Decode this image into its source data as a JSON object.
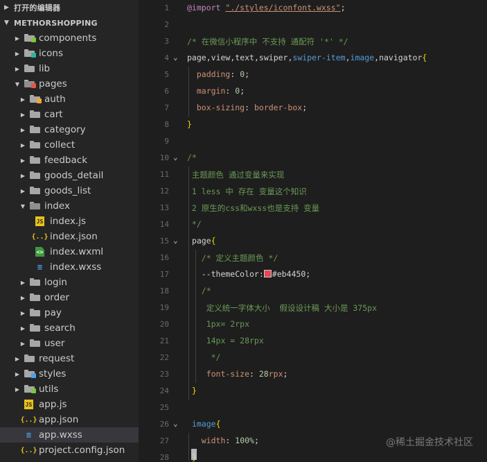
{
  "sidebar": {
    "open_editors": "打开的编辑器",
    "project": "METHORSHOPPING",
    "items": [
      {
        "label": "components",
        "type": "folder",
        "depth": 1,
        "expanded": false,
        "badge": "#7ec542"
      },
      {
        "label": "icons",
        "type": "folder",
        "depth": 1,
        "expanded": false,
        "badge": "#2fb39f"
      },
      {
        "label": "lib",
        "type": "folder",
        "depth": 1,
        "expanded": false,
        "badge": ""
      },
      {
        "label": "pages",
        "type": "folder",
        "depth": 1,
        "expanded": true,
        "badge": "#e2564a"
      },
      {
        "label": "auth",
        "type": "folder",
        "depth": 2,
        "expanded": false,
        "badge": "#f0a830"
      },
      {
        "label": "cart",
        "type": "folder",
        "depth": 2,
        "expanded": false,
        "badge": ""
      },
      {
        "label": "category",
        "type": "folder",
        "depth": 2,
        "expanded": false,
        "badge": ""
      },
      {
        "label": "collect",
        "type": "folder",
        "depth": 2,
        "expanded": false,
        "badge": ""
      },
      {
        "label": "feedback",
        "type": "folder",
        "depth": 2,
        "expanded": false,
        "badge": ""
      },
      {
        "label": "goods_detail",
        "type": "folder",
        "depth": 2,
        "expanded": false,
        "badge": ""
      },
      {
        "label": "goods_list",
        "type": "folder",
        "depth": 2,
        "expanded": false,
        "badge": ""
      },
      {
        "label": "index",
        "type": "folder",
        "depth": 2,
        "expanded": true,
        "badge": ""
      },
      {
        "label": "index.js",
        "type": "js",
        "depth": 3
      },
      {
        "label": "index.json",
        "type": "json",
        "depth": 3
      },
      {
        "label": "index.wxml",
        "type": "wxml",
        "depth": 3
      },
      {
        "label": "index.wxss",
        "type": "wxss",
        "depth": 3
      },
      {
        "label": "login",
        "type": "folder",
        "depth": 2,
        "expanded": false,
        "badge": ""
      },
      {
        "label": "order",
        "type": "folder",
        "depth": 2,
        "expanded": false,
        "badge": ""
      },
      {
        "label": "pay",
        "type": "folder",
        "depth": 2,
        "expanded": false,
        "badge": ""
      },
      {
        "label": "search",
        "type": "folder",
        "depth": 2,
        "expanded": false,
        "badge": ""
      },
      {
        "label": "user",
        "type": "folder",
        "depth": 2,
        "expanded": false,
        "badge": ""
      },
      {
        "label": "request",
        "type": "folder",
        "depth": 1,
        "expanded": false,
        "badge": ""
      },
      {
        "label": "styles",
        "type": "folder",
        "depth": 1,
        "expanded": false,
        "badge": "#4f9fe8"
      },
      {
        "label": "utils",
        "type": "folder",
        "depth": 1,
        "expanded": false,
        "badge": "#7ec542"
      },
      {
        "label": "app.js",
        "type": "js",
        "depth": 1
      },
      {
        "label": "app.json",
        "type": "json",
        "depth": 1
      },
      {
        "label": "app.wxss",
        "type": "wxss",
        "depth": 1,
        "selected": true
      },
      {
        "label": "project.config.json",
        "type": "json",
        "depth": 1
      }
    ]
  },
  "editor": {
    "lines": [
      {
        "n": "1",
        "fold": "",
        "tokens": [
          [
            "kw",
            "@import "
          ],
          [
            "str",
            "\"./styles/iconfont.wxss\""
          ],
          [
            "plain",
            ";"
          ]
        ]
      },
      {
        "n": "2",
        "fold": "",
        "tokens": []
      },
      {
        "n": "3",
        "fold": "",
        "tokens": [
          [
            "cmt",
            "/* 在微信小程序中 不支持 通配符 '*' */"
          ]
        ]
      },
      {
        "n": "4",
        "fold": "v",
        "tokens": [
          [
            "tag",
            "page"
          ],
          [
            "plain",
            ","
          ],
          [
            "tag",
            "view"
          ],
          [
            "plain",
            ","
          ],
          [
            "tag",
            "text"
          ],
          [
            "plain",
            ","
          ],
          [
            "tag",
            "swiper"
          ],
          [
            "plain",
            ","
          ],
          [
            "tag2",
            "swiper-item"
          ],
          [
            "plain",
            ","
          ],
          [
            "tag2",
            "image"
          ],
          [
            "plain",
            ","
          ],
          [
            "tag",
            "navigator"
          ],
          [
            "brace",
            "{"
          ]
        ]
      },
      {
        "n": "5",
        "fold": "",
        "tokens": [
          [
            "plain",
            "  "
          ],
          [
            "val",
            "padding"
          ],
          [
            "plain",
            ": "
          ],
          [
            "num",
            "0"
          ],
          [
            "plain",
            ";"
          ]
        ]
      },
      {
        "n": "6",
        "fold": "",
        "tokens": [
          [
            "plain",
            "  "
          ],
          [
            "val",
            "margin"
          ],
          [
            "plain",
            ": "
          ],
          [
            "num",
            "0"
          ],
          [
            "plain",
            ";"
          ]
        ]
      },
      {
        "n": "7",
        "fold": "",
        "tokens": [
          [
            "plain",
            "  "
          ],
          [
            "val",
            "box-sizing"
          ],
          [
            "plain",
            ": "
          ],
          [
            "val",
            "border-box"
          ],
          [
            "plain",
            ";"
          ]
        ]
      },
      {
        "n": "8",
        "fold": "",
        "tokens": [
          [
            "brace",
            "}"
          ]
        ]
      },
      {
        "n": "9",
        "fold": "",
        "tokens": []
      },
      {
        "n": "10",
        "fold": "v",
        "tokens": [
          [
            "cmt",
            "/*"
          ]
        ]
      },
      {
        "n": "11",
        "fold": "",
        "tokens": [
          [
            "cmt",
            " 主题颜色 通过变量来实现"
          ]
        ]
      },
      {
        "n": "12",
        "fold": "",
        "tokens": [
          [
            "cmt",
            " 1 less 中 存在 变量这个知识"
          ]
        ]
      },
      {
        "n": "13",
        "fold": "",
        "tokens": [
          [
            "cmt",
            " 2 原生的css和wxss也是支持 变量"
          ]
        ]
      },
      {
        "n": "14",
        "fold": "",
        "tokens": [
          [
            "cmt",
            " */"
          ]
        ]
      },
      {
        "n": "15",
        "fold": "v",
        "tokens": [
          [
            "plain",
            " "
          ],
          [
            "tag",
            "page"
          ],
          [
            "brace",
            "{"
          ]
        ]
      },
      {
        "n": "16",
        "fold": "",
        "tokens": [
          [
            "plain",
            "   "
          ],
          [
            "cmt",
            "/* 定义主题颜色 */"
          ]
        ]
      },
      {
        "n": "17",
        "fold": "",
        "tokens": [
          [
            "plain",
            "   --themeColor:"
          ],
          [
            "swatch",
            ""
          ],
          [
            "plain",
            "#eb4450;"
          ]
        ]
      },
      {
        "n": "18",
        "fold": "",
        "tokens": [
          [
            "plain",
            "   "
          ],
          [
            "cmt",
            "/*"
          ]
        ]
      },
      {
        "n": "19",
        "fold": "",
        "tokens": [
          [
            "cmt",
            "    定义统一字体大小  假设设计稿 大小是 375px"
          ]
        ]
      },
      {
        "n": "20",
        "fold": "",
        "tokens": [
          [
            "cmt",
            "    1px= 2rpx"
          ]
        ]
      },
      {
        "n": "21",
        "fold": "",
        "tokens": [
          [
            "cmt",
            "    14px = 28rpx"
          ]
        ]
      },
      {
        "n": "22",
        "fold": "",
        "tokens": [
          [
            "cmt",
            "     */"
          ]
        ]
      },
      {
        "n": "23",
        "fold": "",
        "tokens": [
          [
            "plain",
            "    "
          ],
          [
            "val",
            "font-size"
          ],
          [
            "plain",
            ": "
          ],
          [
            "num",
            "28"
          ],
          [
            "val",
            "rpx"
          ],
          [
            "plain",
            ";"
          ]
        ]
      },
      {
        "n": "24",
        "fold": "",
        "tokens": [
          [
            "plain",
            " "
          ],
          [
            "brace",
            "}"
          ]
        ]
      },
      {
        "n": "25",
        "fold": "",
        "tokens": []
      },
      {
        "n": "26",
        "fold": "v",
        "tokens": [
          [
            "plain",
            " "
          ],
          [
            "tag2",
            "image"
          ],
          [
            "brace",
            "{"
          ]
        ]
      },
      {
        "n": "27",
        "fold": "",
        "tokens": [
          [
            "plain",
            "   "
          ],
          [
            "val",
            "width"
          ],
          [
            "plain",
            ": "
          ],
          [
            "num",
            "100%"
          ],
          [
            "plain",
            ";"
          ]
        ]
      },
      {
        "n": "28",
        "fold": "",
        "tokens": [
          [
            "plain",
            " "
          ],
          [
            "brace",
            "}"
          ]
        ]
      }
    ]
  },
  "watermark": "@稀土掘金技术社区",
  "colors": {
    "theme": "#eb4450"
  },
  "icons": {
    "folder": "folder-icon",
    "js": "js-file-icon",
    "json": "json-file-icon",
    "wxml": "wxml-file-icon",
    "wxss": "wxss-file-icon"
  }
}
